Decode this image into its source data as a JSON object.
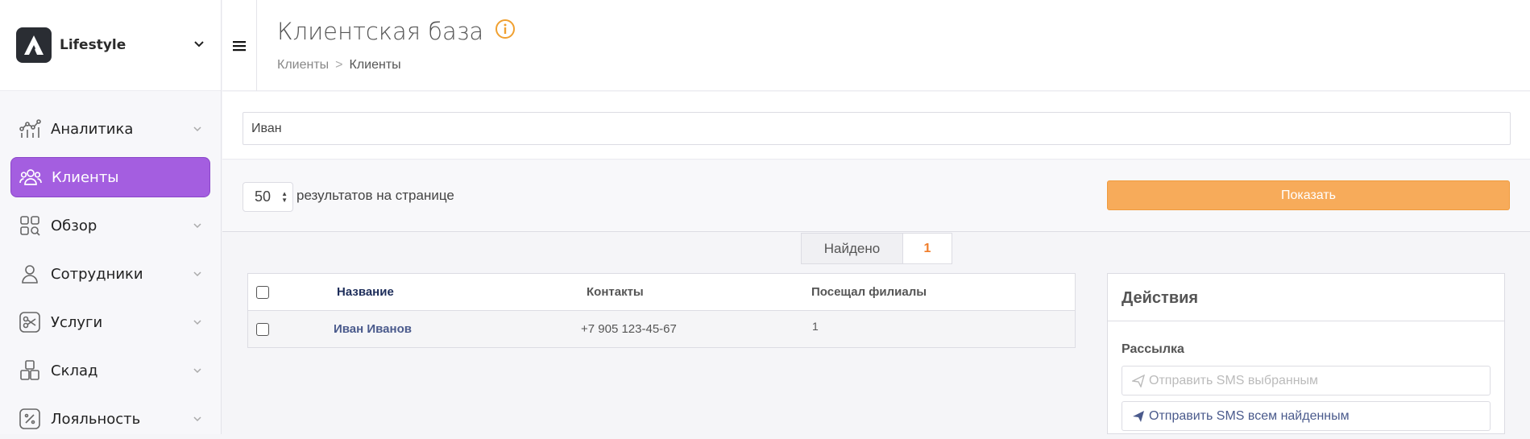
{
  "app": {
    "brand_name": "Lifestyle"
  },
  "sidebar": {
    "items": [
      {
        "label": "Аналитика",
        "icon": "analytics-icon"
      },
      {
        "label": "Клиенты",
        "icon": "clients-icon",
        "active": true
      },
      {
        "label": "Обзор",
        "icon": "overview-icon"
      },
      {
        "label": "Сотрудники",
        "icon": "staff-icon"
      },
      {
        "label": "Услуги",
        "icon": "services-icon"
      },
      {
        "label": "Склад",
        "icon": "warehouse-icon"
      },
      {
        "label": "Лояльность",
        "icon": "loyalty-icon"
      }
    ]
  },
  "header": {
    "title": "Клиентская база",
    "breadcrumb": [
      "Клиенты",
      "Клиенты"
    ]
  },
  "search": {
    "value": "Иван"
  },
  "filters": {
    "per_page_value": "50",
    "per_page_label": "результатов на странице",
    "show_button": "Показать"
  },
  "results": {
    "found_label": "Найдено",
    "found_count": "1"
  },
  "table": {
    "columns": [
      "Название",
      "Контакты",
      "Посещал филиалы"
    ],
    "rows": [
      {
        "name": "Иван Иванов",
        "contact": "+7 905 123-45-67",
        "branches": "1"
      }
    ]
  },
  "actions": {
    "title": "Действия",
    "section": "Рассылка",
    "send_selected": "Отправить SMS выбранным",
    "send_all": "Отправить SMS всем найденным"
  },
  "colors": {
    "accent": "#a45ee0",
    "primary_button": "#f7ab5a",
    "count": "#f07d2a",
    "link": "#4a5a8c"
  }
}
